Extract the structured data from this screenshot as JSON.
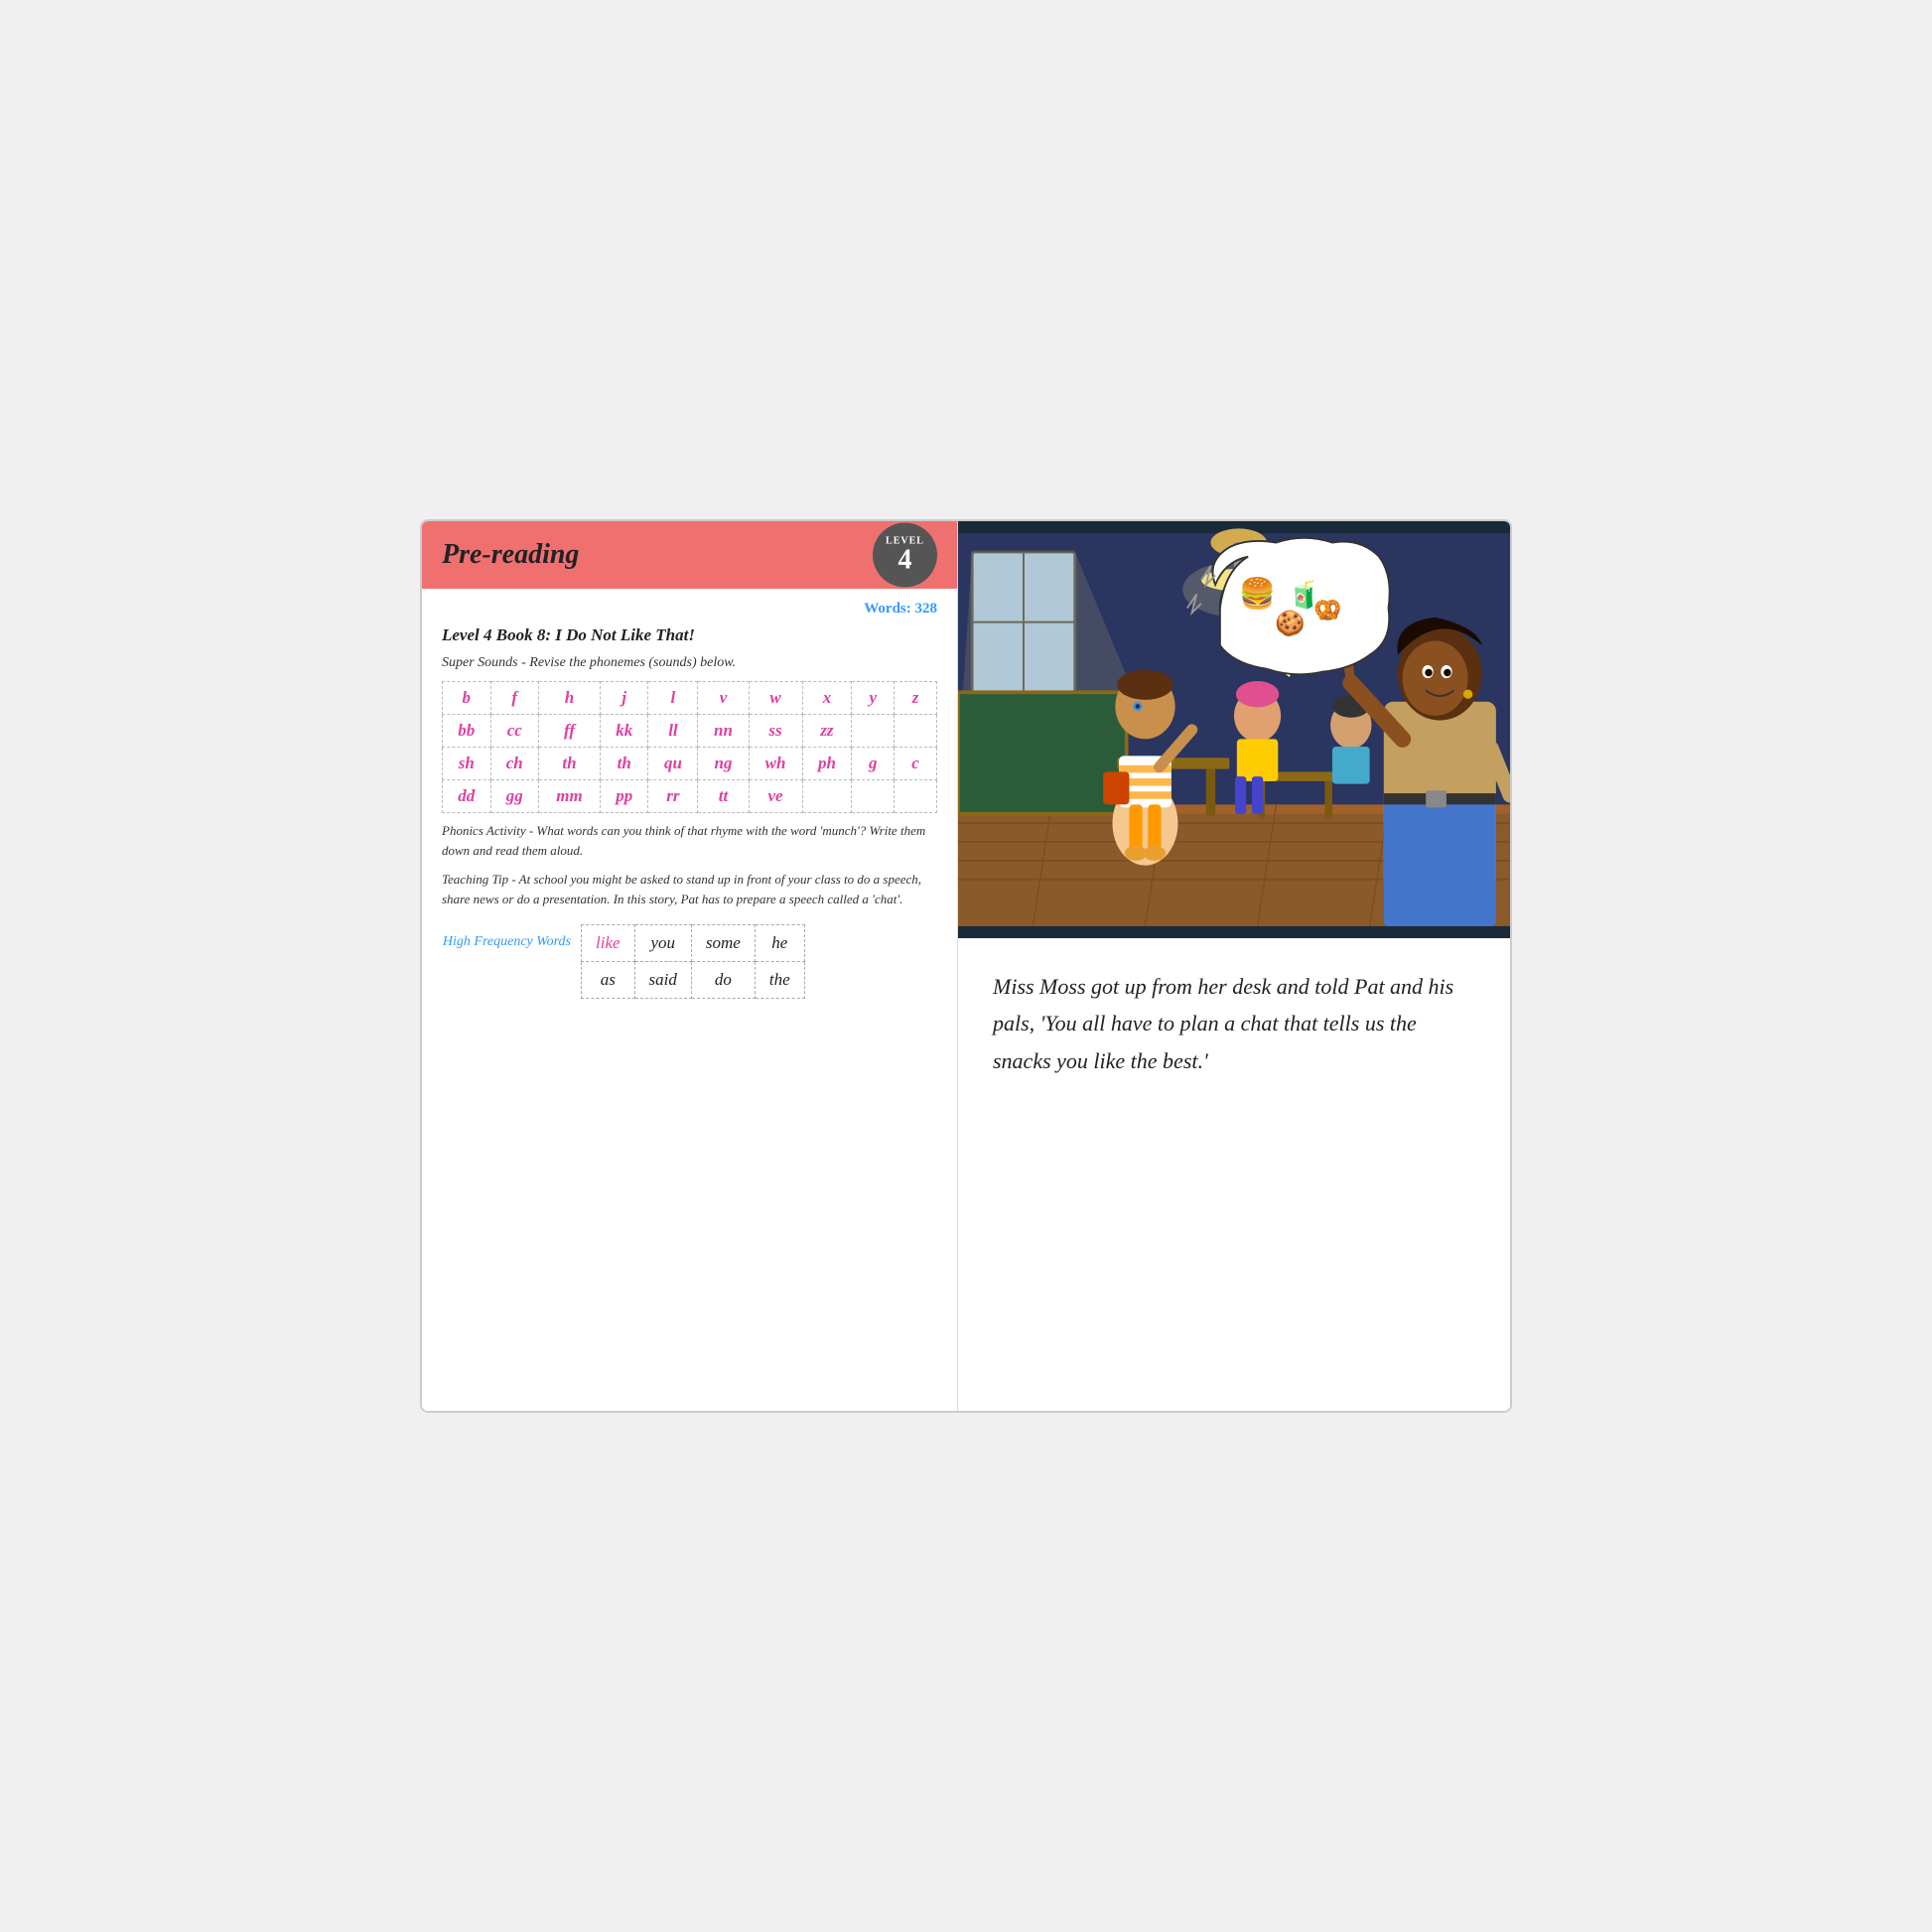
{
  "left": {
    "header": {
      "title": "Pre-reading",
      "level_label": "LEVEL",
      "level_num": "4"
    },
    "words_label": "Words:",
    "words_count": "328",
    "book_title": "Level 4 Book 8: I Do Not Like That!",
    "sounds_subtitle": "Super Sounds - Revise the phonemes (sounds) below.",
    "phonics_rows": [
      [
        "b",
        "f",
        "h",
        "j",
        "l",
        "v",
        "w",
        "x",
        "y",
        "z"
      ],
      [
        "bb",
        "cc",
        "ff",
        "kk",
        "ll",
        "nn",
        "ss",
        "zz",
        "",
        ""
      ],
      [
        "sh",
        "ch",
        "th",
        "th",
        "qu",
        "ng",
        "wh",
        "ph",
        "g",
        "c"
      ],
      [
        "dd",
        "gg",
        "mm",
        "pp",
        "rr",
        "tt",
        "ve",
        "",
        "",
        ""
      ]
    ],
    "phonics_note": "Phonics Activity - What words can you think of that rhyme with the word 'munch'? Write them down and read them aloud.",
    "teaching_tip": "Teaching Tip - At school you might be asked to stand up in front of your class to do a speech, share news or do a presentation. In this story, Pat has to prepare a speech called a 'chat'.",
    "hfw_label": "High Frequency Words",
    "hfw_words": [
      [
        "like",
        "you",
        "some",
        "he"
      ],
      [
        "as",
        "said",
        "do",
        "the"
      ]
    ]
  },
  "right": {
    "story_text": "Miss Moss got up from her desk and told Pat and his pals, 'You all have to plan a chat that tells us the snacks you like the best.'",
    "speech_bubble_emoji": "🍔🧃🍪🥨"
  }
}
